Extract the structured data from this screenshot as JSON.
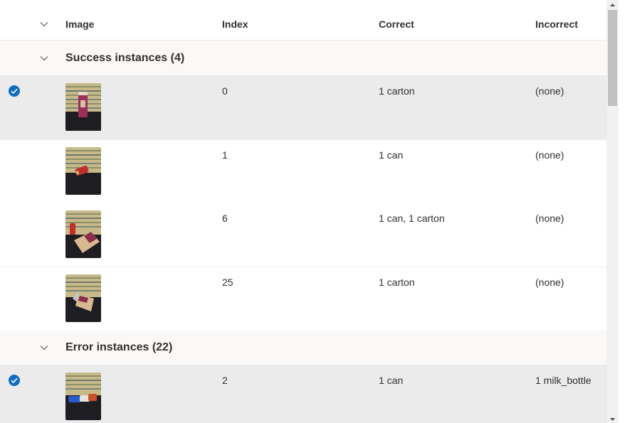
{
  "columns": {
    "image": "Image",
    "index": "Index",
    "correct": "Correct",
    "incorrect": "Incorrect"
  },
  "groups": [
    {
      "title": "Success instances (4)",
      "rows": [
        {
          "index": "0",
          "correct": "1 carton",
          "incorrect": "(none)",
          "selected": true,
          "thumb": "carton"
        },
        {
          "index": "1",
          "correct": "1 can",
          "incorrect": "(none)",
          "selected": false,
          "thumb": "can"
        },
        {
          "index": "6",
          "correct": "1 can, 1 carton",
          "incorrect": "(none)",
          "selected": false,
          "thumb": "can-carton"
        },
        {
          "index": "25",
          "correct": "1 carton",
          "incorrect": "(none)",
          "selected": false,
          "thumb": "carton-lying"
        }
      ]
    },
    {
      "title": "Error instances (22)",
      "rows": [
        {
          "index": "2",
          "correct": "1 can",
          "incorrect": "1 milk_bottle",
          "selected": true,
          "thumb": "can-bottle"
        }
      ]
    }
  ],
  "icons": {
    "header_toggle": "chevron-down-icon",
    "group_toggle": "chevron-down-icon",
    "row_check": "check-circle-icon"
  },
  "colors": {
    "accent": "#0f6cbd",
    "selected_row": "#ebebeb",
    "group_bg": "#faf9f8"
  }
}
